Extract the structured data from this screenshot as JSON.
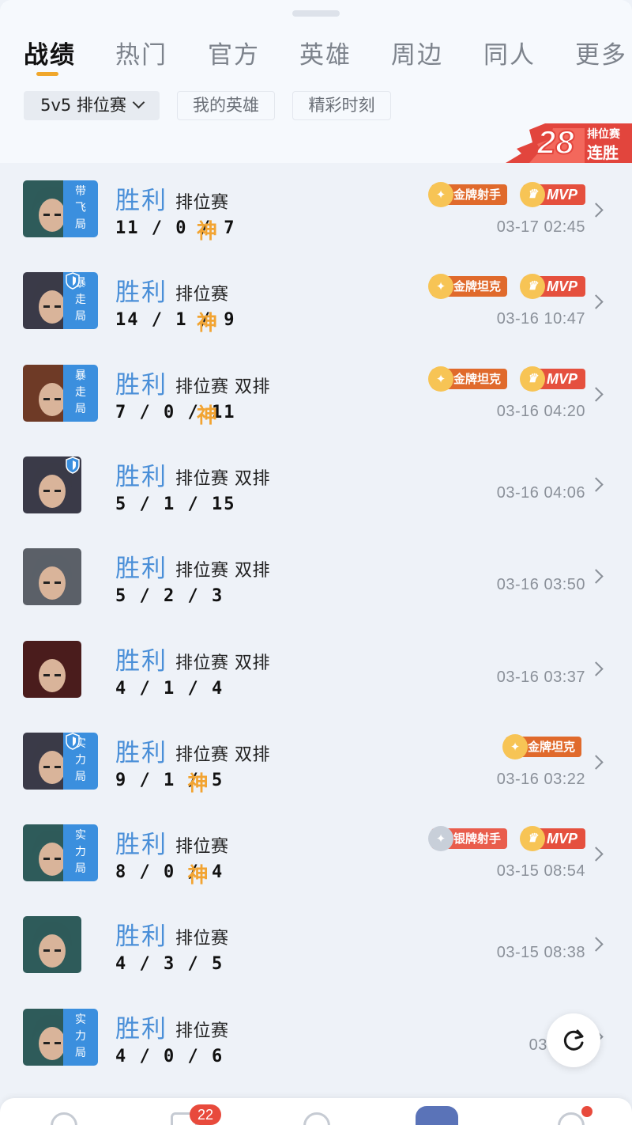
{
  "tabs": [
    {
      "label": "战绩",
      "active": true
    },
    {
      "label": "热门",
      "active": false
    },
    {
      "label": "官方",
      "active": false
    },
    {
      "label": "英雄",
      "active": false
    },
    {
      "label": "周边",
      "active": false
    },
    {
      "label": "同人",
      "active": false
    },
    {
      "label": "更多",
      "active": false
    }
  ],
  "filters": {
    "mode_select": "5v5 排位赛",
    "my_heroes": "我的英雄",
    "highlights": "精彩时刻"
  },
  "streak": {
    "count": "28",
    "label_top": "排位赛",
    "label_bottom": "连胜"
  },
  "matches": [
    {
      "result": "胜利",
      "mode": "排位赛",
      "kda": "11 / 0 / 7",
      "god": "神",
      "time": "03-17 02:45",
      "tag": [
        "带",
        "飞",
        "局"
      ],
      "shield": false,
      "badge": {
        "type": "gold",
        "text": "金牌射手"
      },
      "mvp": "MVP",
      "avatar_color": "#2e5b5a"
    },
    {
      "result": "胜利",
      "mode": "排位赛",
      "kda": "14 / 1 / 9",
      "god": "神",
      "time": "03-16 10:47",
      "tag": [
        "暴",
        "走",
        "局"
      ],
      "shield": true,
      "badge": {
        "type": "gold",
        "text": "金牌坦克"
      },
      "mvp": "MVP",
      "avatar_color": "#3a3a48"
    },
    {
      "result": "胜利",
      "mode": "排位赛 双排",
      "kda": "7 / 0 / 11",
      "god": "神",
      "time": "03-16 04:20",
      "tag": [
        "暴",
        "走",
        "局"
      ],
      "shield": false,
      "badge": {
        "type": "gold",
        "text": "金牌坦克"
      },
      "mvp": "MVP",
      "avatar_color": "#6e3a26"
    },
    {
      "result": "胜利",
      "mode": "排位赛 双排",
      "kda": "5 / 1 / 15",
      "god": "",
      "time": "03-16 04:06",
      "tag": [],
      "shield": true,
      "badge": null,
      "mvp": "",
      "avatar_color": "#3a3a48"
    },
    {
      "result": "胜利",
      "mode": "排位赛 双排",
      "kda": "5 / 2 / 3",
      "god": "",
      "time": "03-16 03:50",
      "tag": [],
      "shield": false,
      "badge": null,
      "mvp": "",
      "avatar_color": "#5b6068"
    },
    {
      "result": "胜利",
      "mode": "排位赛 双排",
      "kda": "4 / 1 / 4",
      "god": "",
      "time": "03-16 03:37",
      "tag": [],
      "shield": false,
      "badge": null,
      "mvp": "",
      "avatar_color": "#4a1c1c"
    },
    {
      "result": "胜利",
      "mode": "排位赛 双排",
      "kda": "9 / 1 / 5",
      "god": "神",
      "time": "03-16 03:22",
      "tag": [
        "实",
        "力",
        "局"
      ],
      "shield": true,
      "badge": {
        "type": "gold",
        "text": "金牌坦克"
      },
      "mvp": "",
      "avatar_color": "#3a3a48"
    },
    {
      "result": "胜利",
      "mode": "排位赛",
      "kda": "8 / 0 / 4",
      "god": "神",
      "time": "03-15 08:54",
      "tag": [
        "实",
        "力",
        "局"
      ],
      "shield": false,
      "badge": {
        "type": "silver",
        "text": "银牌射手"
      },
      "mvp": "MVP",
      "avatar_color": "#2e5b5a"
    },
    {
      "result": "胜利",
      "mode": "排位赛",
      "kda": "4 / 3 / 5",
      "god": "",
      "time": "03-15 08:38",
      "tag": [],
      "shield": false,
      "badge": null,
      "mvp": "",
      "avatar_color": "#2e5b5a"
    },
    {
      "result": "胜利",
      "mode": "排位赛",
      "kda": "4 / 0 / 6",
      "god": "",
      "time": "03-15 0",
      "tag": [
        "实",
        "力",
        "局"
      ],
      "shield": false,
      "badge": null,
      "mvp": "",
      "avatar_color": "#2e5b5a"
    }
  ],
  "bottom_nav": {
    "message_count": "22"
  },
  "colors": {
    "win": "#4a8fd8",
    "accent": "#f0a72c",
    "badge_red": "#e5503e",
    "tag_blue": "#3b8fde"
  }
}
